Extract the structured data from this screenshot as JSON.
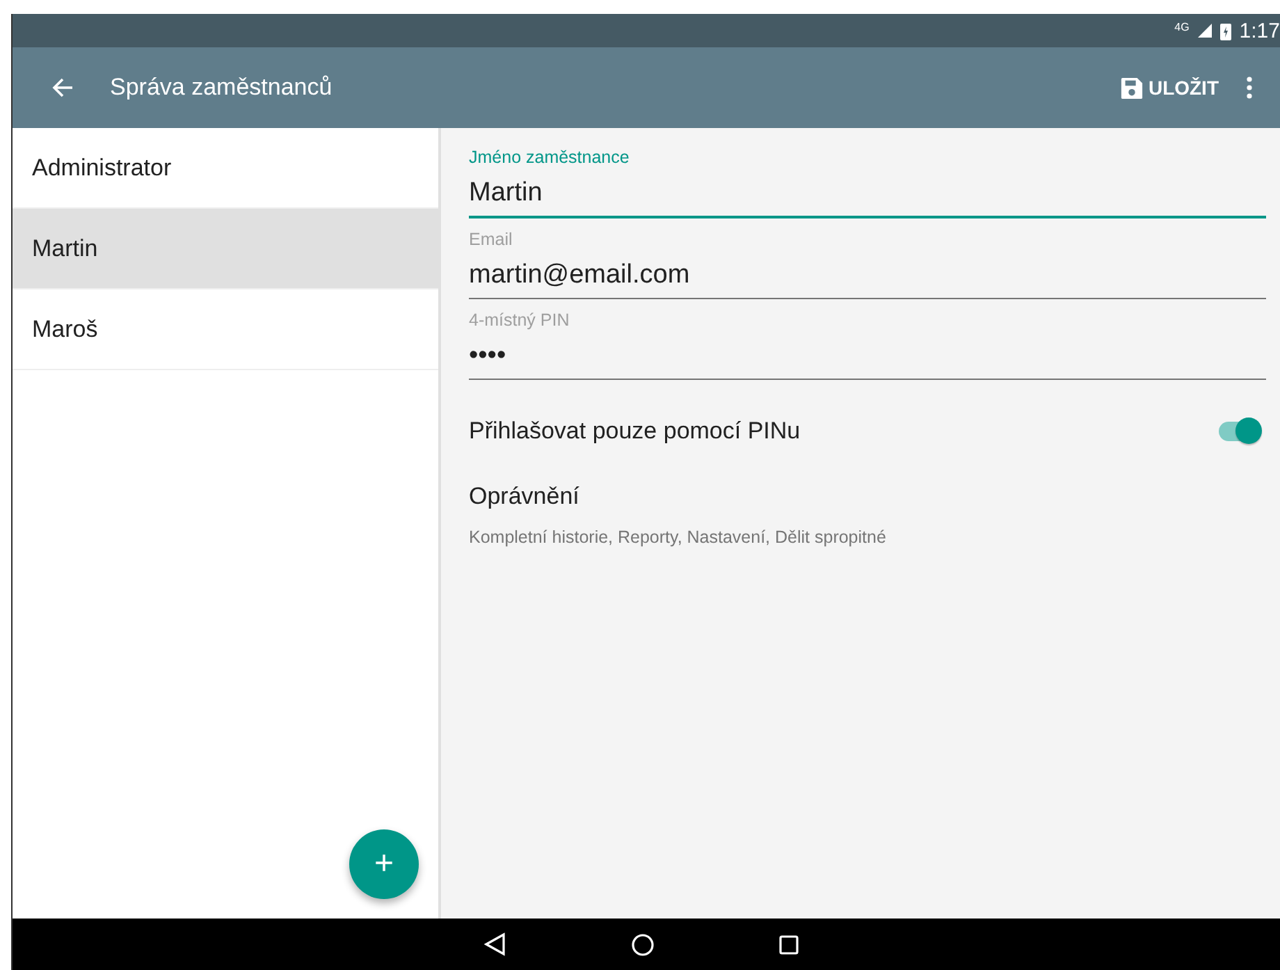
{
  "status_bar": {
    "network": "4G",
    "time": "1:17"
  },
  "app_bar": {
    "title": "Správa zaměstnanců",
    "save_label": "ULOŽIT"
  },
  "employees": [
    {
      "name": "Administrator",
      "selected": false
    },
    {
      "name": "Martin",
      "selected": true
    },
    {
      "name": "Maroš",
      "selected": false
    }
  ],
  "fab": {
    "label": "+"
  },
  "fields": [
    {
      "label": "Jméno zaměstnance",
      "value": "Martin",
      "focused": true
    },
    {
      "label": "Email",
      "value": "martin@email.com",
      "focused": false
    },
    {
      "label": "4-místný PIN",
      "value": "••••",
      "focused": false
    }
  ],
  "pin_only": {
    "label": "Přihlašovat pouze pomocí PINu",
    "on": true
  },
  "permissions": {
    "title": "Oprávnění",
    "summary": "Kompletní historie, Reporty, Nastavení, Dělit spropitné"
  }
}
